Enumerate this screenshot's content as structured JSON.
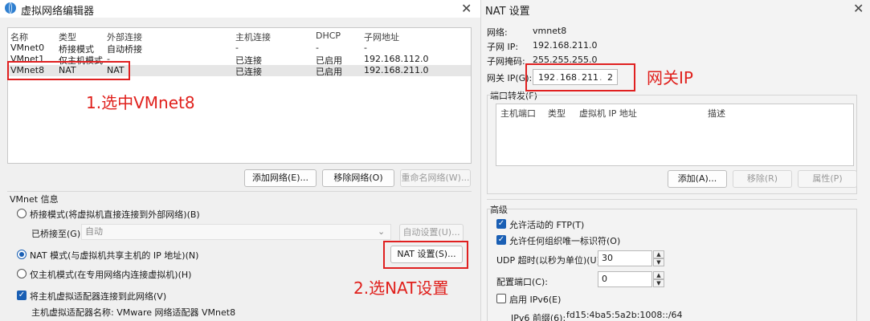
{
  "left": {
    "title": "虚拟网络编辑器",
    "table": {
      "headers": [
        "名称",
        "类型",
        "外部连接",
        "主机连接",
        "DHCP",
        "子网地址"
      ],
      "rows": [
        [
          "VMnet0",
          "桥接模式",
          "自动桥接",
          "-",
          "-",
          "-"
        ],
        [
          "VMnet1",
          "仅主机模式",
          "-",
          "已连接",
          "已启用",
          "192.168.112.0"
        ],
        [
          "VMnet8",
          "NAT",
          "NAT",
          "已连接",
          "已启用",
          "192.168.211.0"
        ]
      ]
    },
    "annot1": "1.选中VMnet8",
    "buttons": {
      "add": "添加网络(E)...",
      "remove": "移除网络(O)",
      "rename": "重命名网络(W)..."
    },
    "info_label": "VMnet 信息",
    "bridge_label": "桥接模式(将虚拟机直接连接到外部网络)(B)",
    "bridged_to_label": "已桥接至(G):",
    "bridged_to_value": "自动",
    "auto_btn": "自动设置(U)...",
    "nat_label": "NAT 模式(与虚拟机共享主机的 IP 地址)(N)",
    "nat_btn": "NAT 设置(S)...",
    "hostonly_label": "仅主机模式(在专用网络内连接虚拟机)(H)",
    "annot2": "2.选NAT设置",
    "connect_adapter": "将主机虚拟适配器连接到此网络(V)",
    "adapter_name": "主机虚拟适配器名称: VMware 网络适配器 VMnet8"
  },
  "right": {
    "title": "NAT 设置",
    "network_label": "网络:",
    "network_value": "vmnet8",
    "subnet_ip_label": "子网 IP:",
    "subnet_ip_value": "192.168.211.0",
    "mask_label": "子网掩码:",
    "mask_value": "255.255.255.0",
    "gw_label": "网关 IP(G):",
    "gw_octets": [
      "192",
      "168",
      "211",
      "2"
    ],
    "annot_gw": "网关IP",
    "port_fwd_label": "端口转发(F)",
    "pf_headers": [
      "主机端口",
      "类型",
      "虚拟机 IP 地址",
      "描述"
    ],
    "pf_buttons": {
      "add": "添加(A)...",
      "remove": "移除(R)",
      "props": "属性(P)"
    },
    "advanced_label": "高级",
    "allow_ftp": "允许活动的 FTP(T)",
    "allow_oid": "允许任何组织唯一标识符(O)",
    "udp_label": "UDP 超时(以秒为单位)(U):",
    "udp_value": "30",
    "config_port_label": "配置端口(C):",
    "config_port_value": "0",
    "ipv6_label": "启用 IPv6(E)",
    "ipv6_prefix_label": "IPv6 前缀(6):",
    "ipv6_prefix_value": "fd15:4ba5:5a2b:1008::/64"
  },
  "colors": {
    "annotation": "#e02020",
    "accent": "#1a5fb4"
  }
}
